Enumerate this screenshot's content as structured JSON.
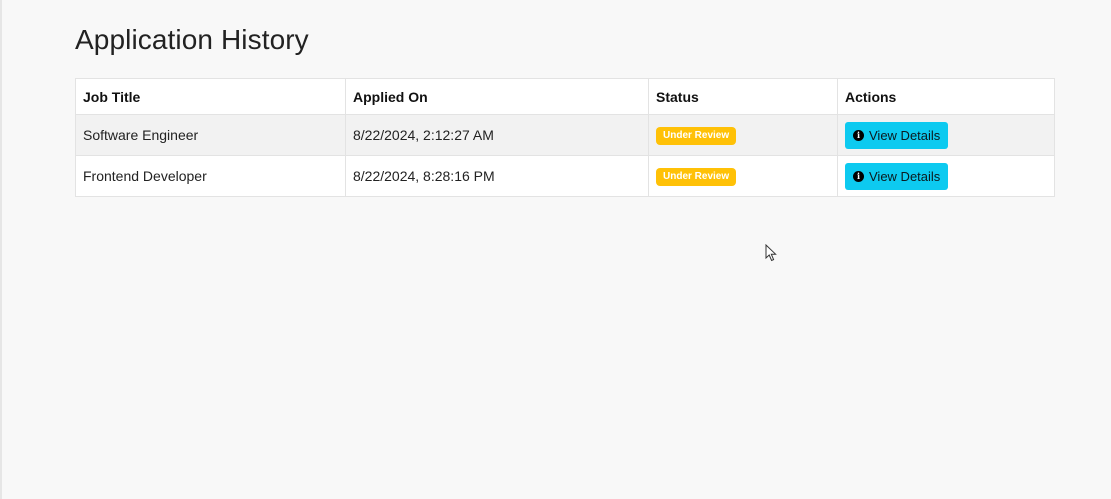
{
  "header": {
    "title": "Application History"
  },
  "table": {
    "columns": [
      "Job Title",
      "Applied On",
      "Status",
      "Actions"
    ],
    "rows": [
      {
        "job_title": "Software Engineer",
        "applied_on": "8/22/2024, 2:12:27 AM",
        "status": "Under Review",
        "action_label": "View Details"
      },
      {
        "job_title": "Frontend Developer",
        "applied_on": "8/22/2024, 8:28:16 PM",
        "status": "Under Review",
        "action_label": "View Details"
      }
    ]
  },
  "icons": {
    "info": "info-circle-icon",
    "cursor": "mouse-pointer-icon"
  },
  "colors": {
    "status_badge": "#ffc107",
    "action_button": "#0dcaf0"
  }
}
